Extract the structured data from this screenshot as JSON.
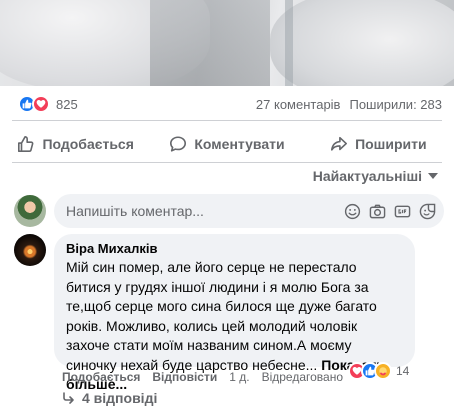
{
  "post": {
    "reaction_count": "825",
    "comments_count": "27 коментарів",
    "shares_count": "Поширили: 283"
  },
  "actions": {
    "like": "Подобається",
    "comment": "Коментувати",
    "share": "Поширити"
  },
  "sort": {
    "label": "Найактуальніші"
  },
  "composer": {
    "placeholder": "Напишіть коментар..."
  },
  "comment": {
    "author": "Віра Михалків",
    "text": "Мій син помер, але його серце не перестало битися у грудях іншої людини і я молю Бога за те,щоб серце мого сина билося ще дуже багато років. Можливо, колись цей молодий чоловік захоче стати моїм названим сином.А моєму синочку нехай буде царство небесне...",
    "see_more": "Показати більше...",
    "like_label": "Подобається",
    "reply_label": "Відповісти",
    "time": "1 д.",
    "edited": "Відредаговано",
    "reaction_count": "14",
    "replies_label": "4 відповіді"
  },
  "colors": {
    "like_blue": "#1877f2",
    "love_red": "#f33e58",
    "care_yellow": "#f7b125",
    "secondary_text": "#65676b",
    "bubble_bg": "#f0f2f5"
  }
}
